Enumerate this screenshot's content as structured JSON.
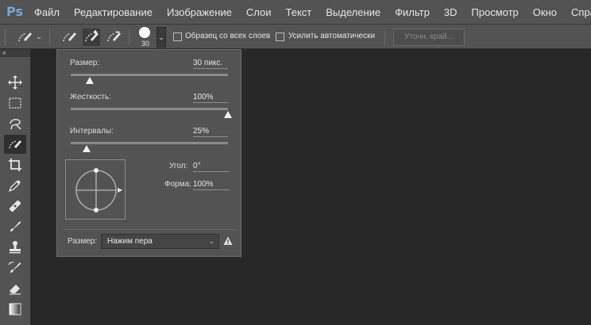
{
  "app": {
    "logo": "Ps"
  },
  "menu": [
    "Файл",
    "Редактирование",
    "Изображение",
    "Слои",
    "Текст",
    "Выделение",
    "Фильтр",
    "3D",
    "Просмотр",
    "Окно",
    "Справка"
  ],
  "options": {
    "brush_size": "30",
    "sample_all_layers_label": "Образец со всех слоев",
    "sample_all_layers_checked": false,
    "auto_enhance_label": "Усилить автоматически",
    "auto_enhance_checked": false,
    "refine_edge_label": "Уточн. край..."
  },
  "toolbar": {
    "collapse_glyph": "»",
    "tools": [
      "move-tool",
      "marquee-tool",
      "lasso-tool",
      "quick-selection-tool",
      "crop-tool",
      "eyedropper-tool",
      "healing-brush-tool",
      "brush-tool",
      "clone-stamp-tool",
      "history-brush-tool",
      "eraser-tool",
      "gradient-tool"
    ],
    "active_tool": "quick-selection-tool"
  },
  "brush_panel": {
    "size": {
      "label": "Размер:",
      "value": "30 пикс.",
      "level": 0.12
    },
    "hardness": {
      "label": "Жесткость:",
      "value": "100%",
      "level": 1.0
    },
    "spacing": {
      "label": "Интервалы:",
      "value": "25%",
      "level": 0.1
    },
    "angle": {
      "label": "Угол:",
      "value": "0°"
    },
    "roundness": {
      "label": "Форма:",
      "value": "100%"
    },
    "size_control": {
      "label": "Размер:",
      "selected": "Нажим пера"
    }
  }
}
